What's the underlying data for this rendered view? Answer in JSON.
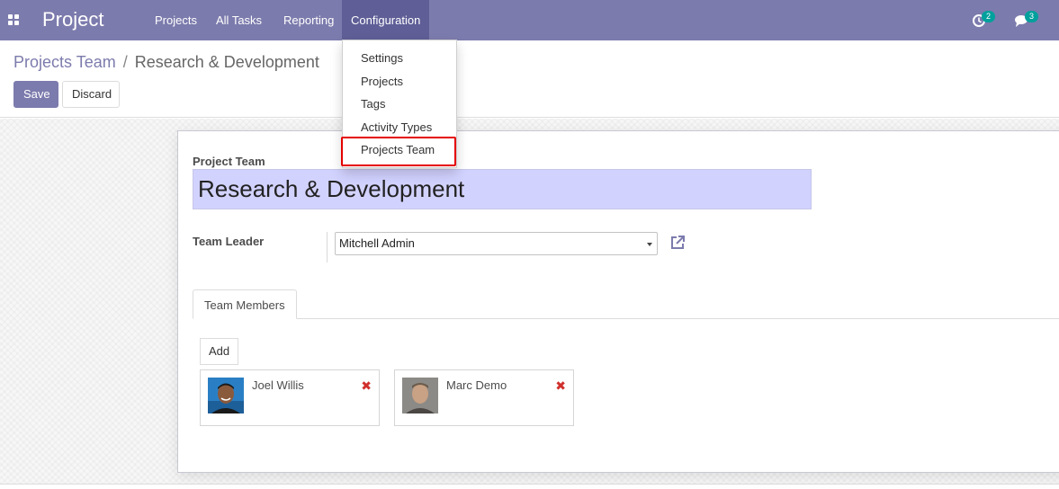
{
  "navbar": {
    "brand": "Project",
    "menu": [
      "Projects",
      "All Tasks",
      "Reporting",
      "Configuration"
    ],
    "active_menu": "Configuration",
    "activity_count": "2",
    "messages_count": "3"
  },
  "dropdown": {
    "items": [
      "Settings",
      "Projects",
      "Tags",
      "Activity Types",
      "Projects Team"
    ],
    "highlighted": "Projects Team"
  },
  "breadcrumb": {
    "parent": "Projects Team",
    "separator": "/",
    "current": "Research & Development"
  },
  "buttons": {
    "save": "Save",
    "discard": "Discard"
  },
  "form": {
    "name_label": "Project Team",
    "name_value": "Research & Development",
    "leader_label": "Team Leader",
    "leader_value": "Mitchell Admin",
    "tab_label": "Team Members",
    "add_label": "Add",
    "members": [
      {
        "name": "Joel Willis"
      },
      {
        "name": "Marc Demo"
      }
    ]
  },
  "colors": {
    "brand": "#7c7bad",
    "active_menu_bg": "#5f5e97",
    "highlight_border": "#e50000",
    "name_field_bg": "#d2d2ff",
    "badge": "#00a09d",
    "remove_icon": "#d0302c"
  },
  "icons": [
    "apps-grid-icon",
    "activity-clock-icon",
    "messages-chat-icon",
    "caret-down-icon",
    "external-link-icon",
    "remove-x-icon"
  ]
}
